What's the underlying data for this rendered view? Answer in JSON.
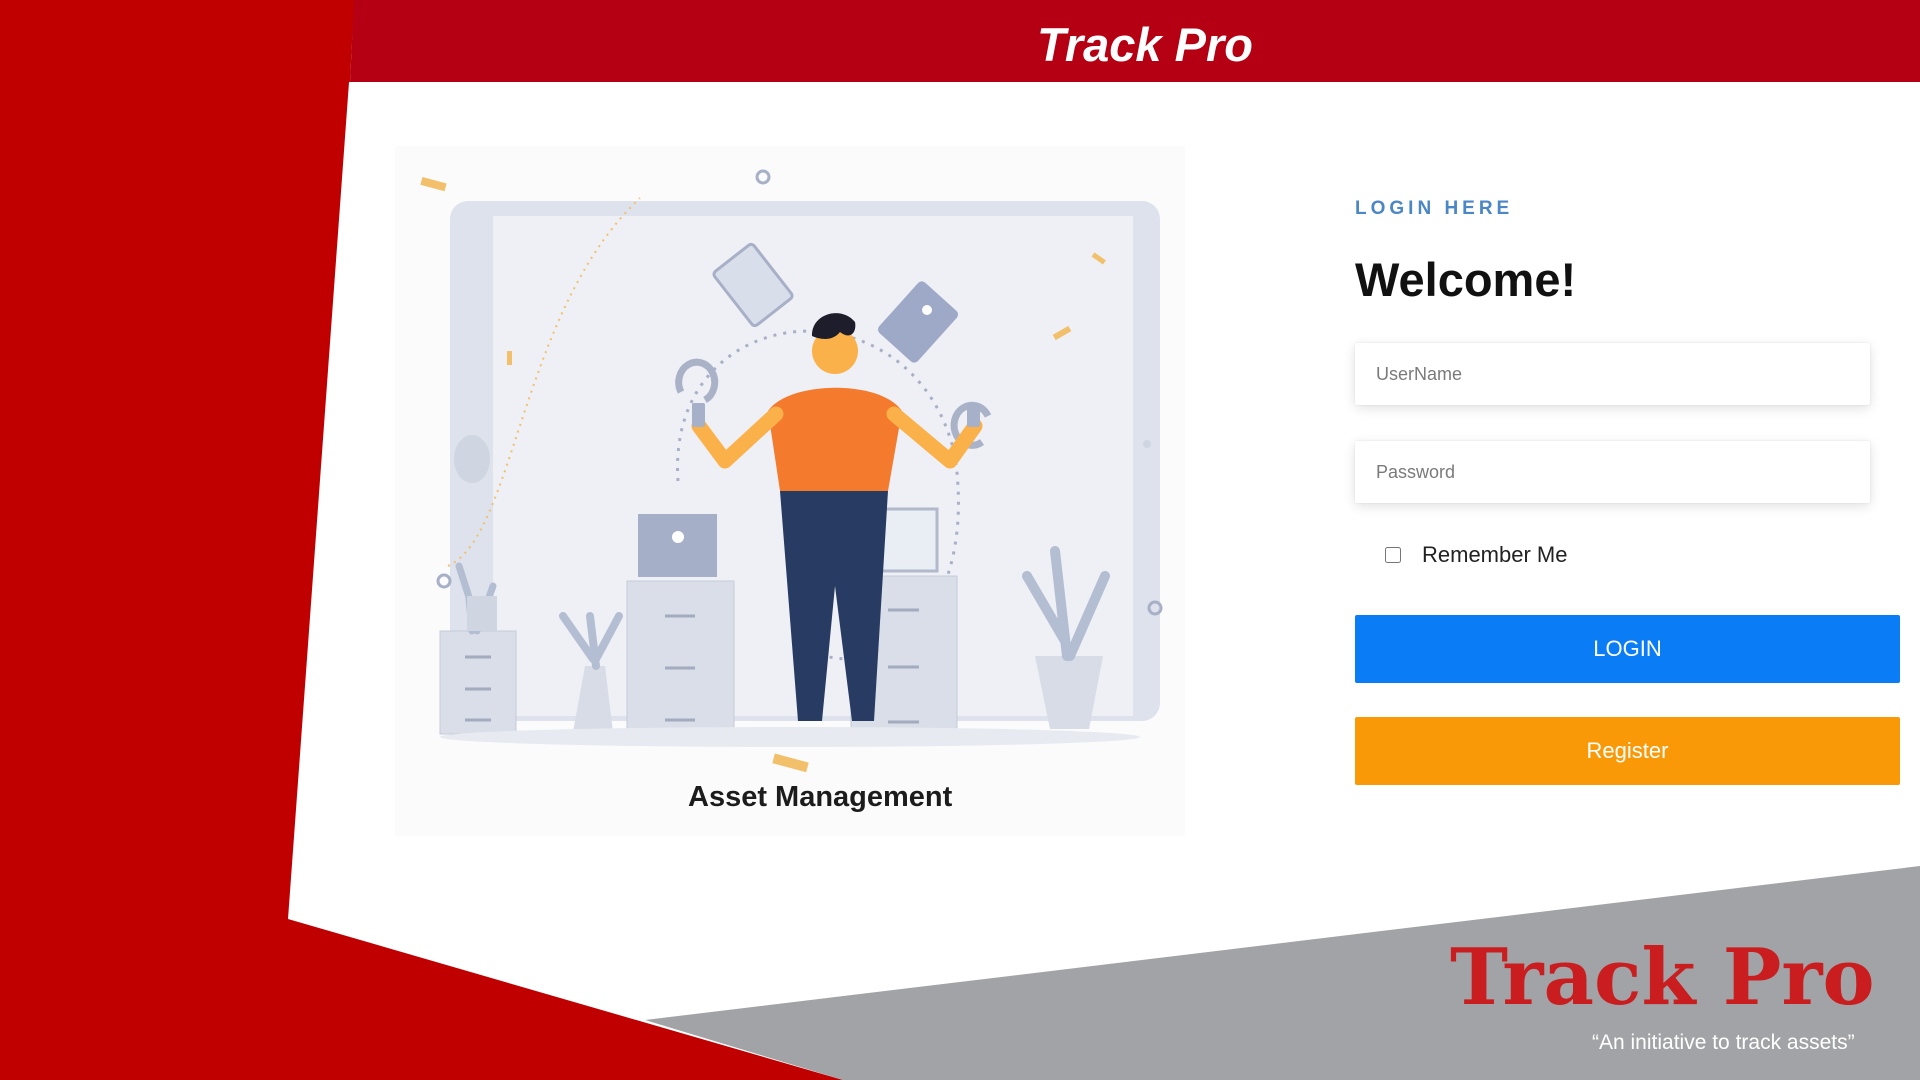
{
  "header": {
    "title": "Track Pro"
  },
  "illustration": {
    "caption": "Asset Management",
    "icon": "asset-manager-illustration"
  },
  "login": {
    "section_label": "LOGIN HERE",
    "welcome": "Welcome!",
    "username_placeholder": "UserName",
    "password_placeholder": "Password",
    "remember_label": "Remember Me",
    "remember_checked": false,
    "login_label": "LOGIN",
    "register_label": "Register"
  },
  "brand": {
    "name": "Track Pro",
    "tagline": "“An initiative to track assets”"
  },
  "colors": {
    "brand_red": "#c00000",
    "header_red": "#b50014",
    "panel_grey": "#a2a3a6",
    "login_blue": "#0a7cf6",
    "register_orange": "#fa9908",
    "label_blue": "#4b86c5"
  }
}
